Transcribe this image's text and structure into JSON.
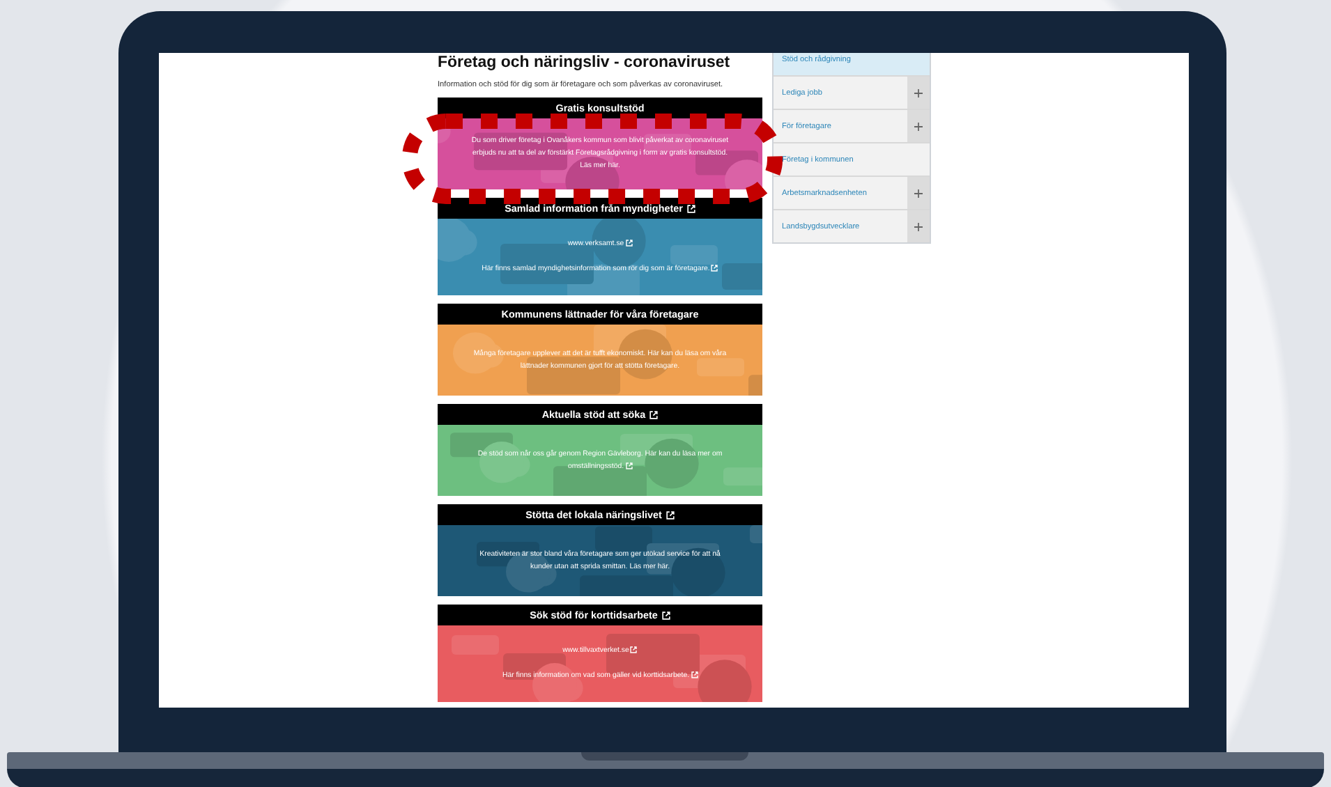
{
  "page": {
    "title": "Företag och näringsliv - coronaviruset",
    "intro": "Information och stöd för dig som är företagare och som påverkas av coronaviruset."
  },
  "cards": [
    {
      "title": "Gratis konsultstöd",
      "external": false,
      "color": "#d6509c",
      "paragraphs": [
        {
          "text": "Du som driver företag i Ovanåkers kommun som blivit påverkat av coronaviruset erbjuds nu att ta del av förstärkt Företagsrådgivning i form av gratis konsultstöd. Läs mer här.",
          "external": false
        }
      ]
    },
    {
      "title": "Samlad information från myndigheter",
      "external": true,
      "color": "#3a8db0",
      "paragraphs": [
        {
          "text": "www.verksamt.se",
          "external": true
        },
        {
          "text": "Här finns samlad myndighetsinformation som rör dig som är företagare.",
          "external": true
        }
      ]
    },
    {
      "title": "Kommunens lättnader för våra företagare",
      "external": false,
      "color": "#f0a050",
      "paragraphs": [
        {
          "text": "Många företagare upplever att det är tufft ekonomiskt. Här kan du läsa om våra lättnader kommunen gjort för att stötta företagare.",
          "external": false
        }
      ]
    },
    {
      "title": "Aktuella stöd att söka",
      "external": true,
      "color": "#6dbf80",
      "paragraphs": [
        {
          "text": "De stöd som når oss går genom Region Gävleborg. Här kan du läsa mer om omställningsstöd.",
          "external": true
        }
      ]
    },
    {
      "title": "Stötta det lokala näringslivet",
      "external": true,
      "color": "#1e5876",
      "paragraphs": [
        {
          "text": "Kreativiteten är stor bland våra företagare som ger utökad service för att nå kunder utan att sprida smittan. Läs mer här.",
          "external": false
        }
      ]
    },
    {
      "title": "Sök stöd för korttidsarbete",
      "external": true,
      "color": "#e85c60",
      "paragraphs": [
        {
          "text": "www.tillvaxtverket.se",
          "external": true
        },
        {
          "text": "Här finns information om vad som gäller vid korttidsarbete.",
          "external": true
        }
      ]
    }
  ],
  "sidebar": {
    "items": [
      {
        "label": "Stöd och rådgivning",
        "selected": true,
        "expandable": false
      },
      {
        "label": "Lediga jobb",
        "selected": false,
        "expandable": true
      },
      {
        "label": "För företagare",
        "selected": false,
        "expandable": true
      },
      {
        "label": "Företag i kommunen",
        "selected": false,
        "expandable": false
      },
      {
        "label": "Arbetsmarknadsenheten",
        "selected": false,
        "expandable": true
      },
      {
        "label": "Landsbygdsutvecklare",
        "selected": false,
        "expandable": true
      }
    ]
  }
}
